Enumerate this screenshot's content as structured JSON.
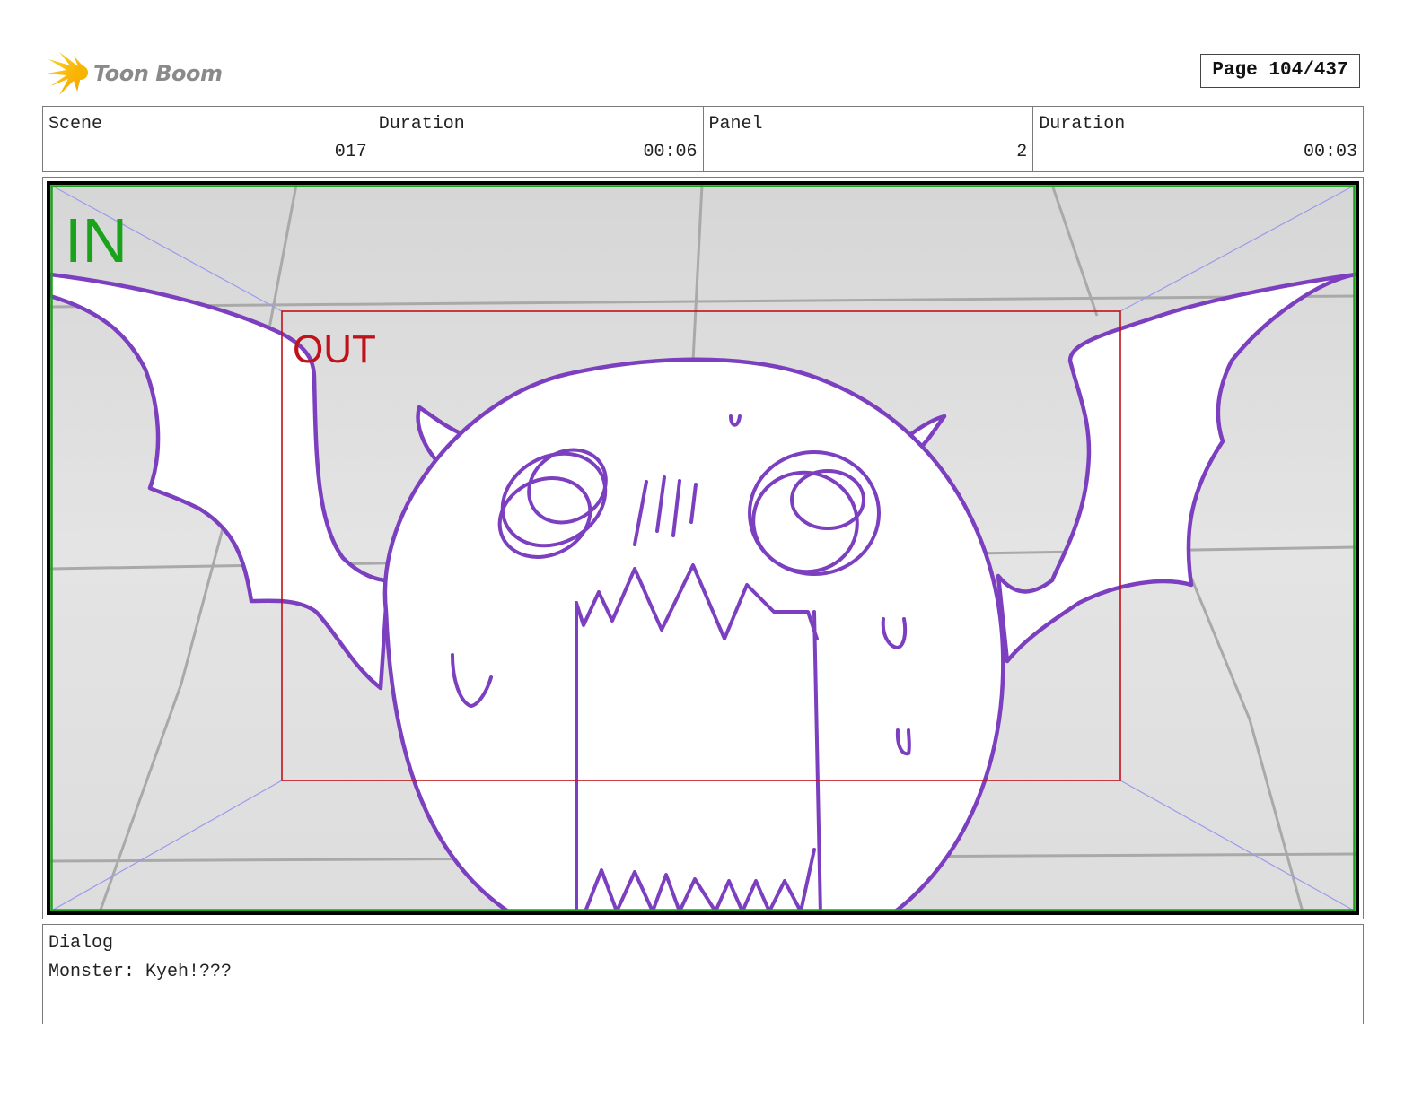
{
  "header": {
    "logo_text": "Toon Boom",
    "page_indicator": "Page 104/437"
  },
  "info": {
    "scene_label": "Scene",
    "scene_value": "017",
    "scene_duration_label": "Duration",
    "scene_duration_value": "00:06",
    "panel_label": "Panel",
    "panel_value": "2",
    "panel_duration_label": "Duration",
    "panel_duration_value": "00:03"
  },
  "panel": {
    "in_label": "IN",
    "out_label": "OUT",
    "colors": {
      "in_frame": "#1aa21a",
      "out_frame": "#c0121a",
      "sketch": "#7b3fbf",
      "background": "#dedede",
      "grid_lines": "#a9a9a9",
      "camera_guides": "#9a9aee"
    }
  },
  "dialog": {
    "label": "Dialog",
    "text": "Monster: Kyeh!???"
  }
}
